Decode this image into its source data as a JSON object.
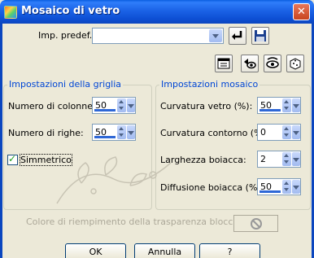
{
  "window": {
    "title": "Mosaico di vetro",
    "close_glyph": "✕"
  },
  "preset": {
    "label": "Imp. predef.:",
    "value": ""
  },
  "grid_group": {
    "title": "Impostazioni della griglia",
    "columns_label": "Numero di colonne:",
    "columns_value": "50",
    "rows_label": "Numero di righe:",
    "rows_value": "50",
    "symmetric_label": "Simmetrico",
    "symmetric_checked": true
  },
  "mosaic_group": {
    "title": "Impostazioni mosaico",
    "glass_curvature_label": "Curvatura vetro (%):",
    "glass_curvature_value": "50",
    "edge_curvature_label": "Curvatura contorno (%):",
    "edge_curvature_value": "0",
    "grout_width_label": "Larghezza boiacca:",
    "grout_width_value": "2",
    "grout_diffusion_label": "Diffusione boiacca (%):",
    "grout_diffusion_value": "50"
  },
  "transparency_fill_label": "Colore di riempimento della trasparenza bloccato:",
  "buttons": {
    "ok": "OK",
    "cancel": "Annulla",
    "help": "?"
  },
  "colors": {
    "title_bar": "#0b46bf",
    "group_title": "#0046d5",
    "dialog_bg": "#ece9d8"
  }
}
